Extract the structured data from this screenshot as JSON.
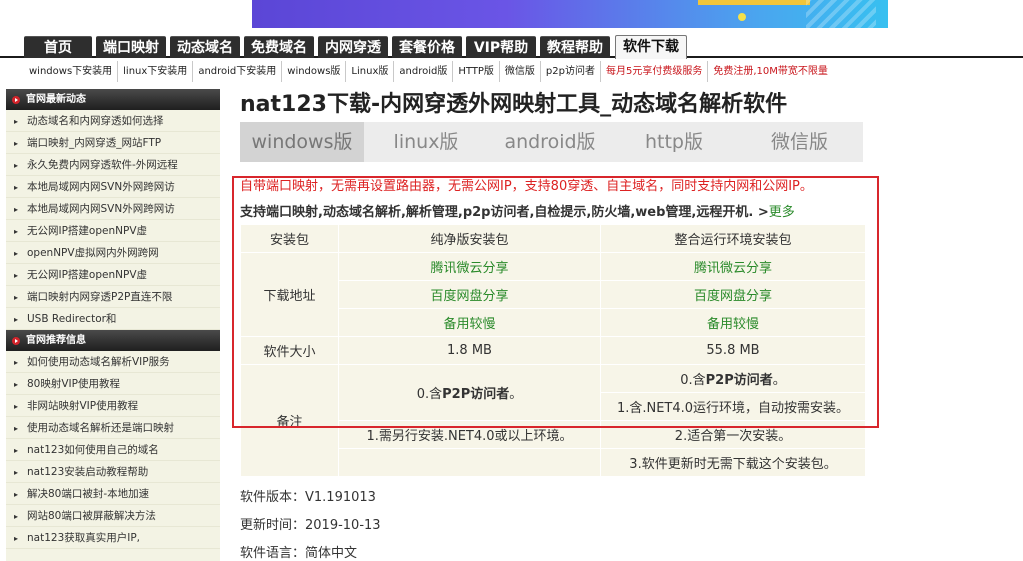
{
  "colors": {
    "accent_red": "#d8262c",
    "link_green": "#2a8a2a",
    "nav_dark": "#2e2e2e"
  },
  "main_nav": [
    "首页",
    "端口映射",
    "动态域名",
    "免费域名",
    "内网穿透",
    "套餐价格",
    "VIP帮助",
    "教程帮助",
    "软件下载"
  ],
  "sub_nav": [
    "windows下安装用",
    "linux下安装用",
    "android下安装用",
    "windows版",
    "Linux版",
    "android版",
    "HTTP版",
    "微信版",
    "p2p访问者",
    "每月5元享付费级服务",
    "免费注册,10M带宽不限量"
  ],
  "sidebar": {
    "section1": {
      "title": "官网最新动态",
      "items": [
        "动态域名和内网穿透如何选择",
        "端口映射_内网穿透_网站FTP",
        "永久免费内网穿透软件-外网远程",
        "本地局域网内网SVN外网跨网访",
        "本地局域网内网SVN外网跨网访",
        "无公网IP搭建openNPV虚",
        "openNPV虚拟网内外网跨网",
        "无公网IP搭建openNPV虚",
        "端口映射内网穿透P2P直连不限",
        "USB Redirector和"
      ]
    },
    "section2": {
      "title": "官网推荐信息",
      "items": [
        "如何使用动态域名解析VIP服务",
        "80映射VIP使用教程",
        "非网站映射VIP使用教程",
        "使用动态域名解析还是端口映射",
        "nat123如何使用自己的域名",
        "nat123安装启动教程帮助",
        "解决80端口被封-本地加速",
        "网站80端口被屏蔽解决方法",
        "nat123获取真实用户IP,"
      ]
    }
  },
  "page_title": "nat123下载-内网穿透外网映射工具_动态域名解析软件",
  "version_tabs": [
    "windows版",
    "linux版",
    "android版",
    "http版",
    "微信版"
  ],
  "red_notice": "自带端口映射，无需再设置路由器，无需公网IP，支持80穿透、自主域名，同时支持内网和公网IP。",
  "features": {
    "text": "支持端口映射,动态域名解析,解析管理,p2p访问者,自检提示,防火墙,web管理,远程开机. >",
    "more": "更多"
  },
  "table": {
    "header": {
      "c0": "安装包",
      "c1": "纯净版安装包",
      "c2": "整合运行环境安装包"
    },
    "download_label": "下载地址",
    "links": [
      "腾讯微云分享",
      "百度网盘分享",
      "备用较慢"
    ],
    "size_label": "软件大小",
    "size": {
      "c1": "1.8 MB",
      "c2": "55.8 MB"
    },
    "notes_label": "备注",
    "notes": {
      "c1_a_prefix": "0.含",
      "c1_a_bold": "P2P访问者",
      "c1_a_suffix": "。",
      "c1_b": "1.需另行安装.NET4.0或以上环境。",
      "c2_a_prefix": "0.含",
      "c2_a_bold": "P2P访问者",
      "c2_a_suffix": "。",
      "c2_b": "1.含.NET4.0运行环境，自动按需安装。",
      "c2_c": "2.适合第一次安装。",
      "c2_d": "3.软件更新时无需下载这个安装包。"
    }
  },
  "info": {
    "version": "软件版本：V1.191013",
    "updated": "更新时间：2019-10-13",
    "language": "软件语言：简体中文"
  }
}
